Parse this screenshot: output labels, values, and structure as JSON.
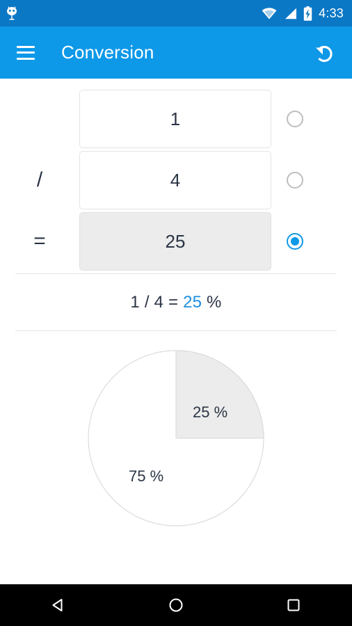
{
  "status_bar": {
    "background": "#0b78c6",
    "time": "4:33",
    "icons": [
      "android-debug-icon",
      "wifi-icon",
      "cell-signal-icon",
      "battery-charging-icon"
    ]
  },
  "app_bar": {
    "background": "#0d98e8",
    "title": "Conversion",
    "menu_icon": "hamburger-menu-icon",
    "undo_icon": "undo-icon"
  },
  "converter": {
    "rows": [
      {
        "operator": "",
        "value": "1",
        "selected": false
      },
      {
        "operator": "/",
        "value": "4",
        "selected": false
      },
      {
        "operator": "=",
        "value": "25",
        "selected": true
      }
    ],
    "accent_color": "#0d98e8"
  },
  "result": {
    "prefix": "1 / 4 = ",
    "value": "25",
    "suffix": " %",
    "accent_color": "#1e8fe0"
  },
  "chart_data": {
    "type": "pie",
    "title": "",
    "categories": [
      "25 %",
      "75 %"
    ],
    "values": [
      25,
      75
    ],
    "labels": [
      "25 %",
      "75 %"
    ],
    "colors": [
      "#ececec",
      "#ffffff"
    ],
    "stroke": "#dcdcdc",
    "start_angle": 0,
    "legend": "none",
    "label_positions": [
      "inside-top-right",
      "inside-bottom-left"
    ]
  },
  "nav_bar": {
    "background": "#000000",
    "buttons": [
      {
        "name": "back-button",
        "icon": "triangle-left-icon"
      },
      {
        "name": "home-button",
        "icon": "circle-icon"
      },
      {
        "name": "recents-button",
        "icon": "square-icon"
      }
    ]
  }
}
